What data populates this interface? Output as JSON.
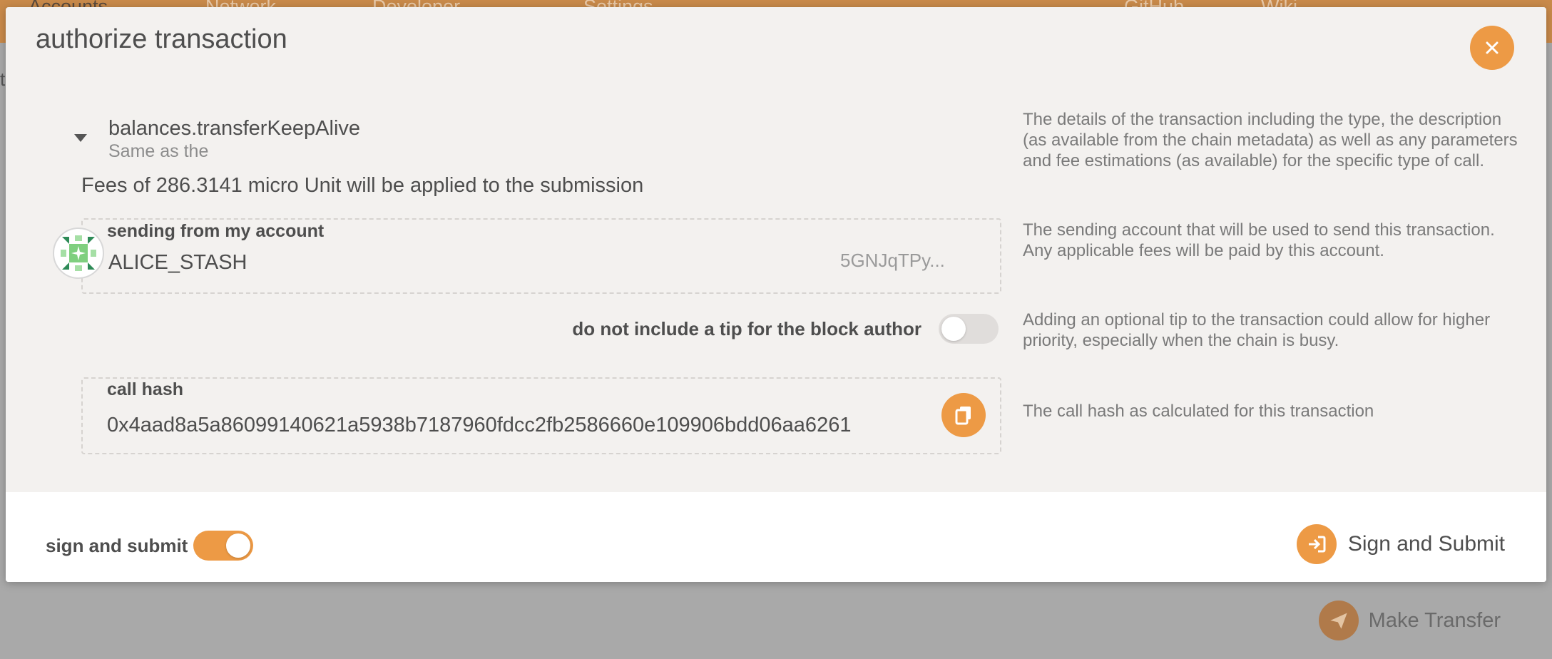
{
  "background": {
    "nav": [
      "Accounts",
      "Network",
      "Developer",
      "Settings",
      "GitHub",
      "Wiki"
    ],
    "fragment": "t",
    "make_transfer_label": "Make Transfer"
  },
  "modal": {
    "title": "authorize transaction",
    "call": {
      "method": "balances.transferKeepAlive",
      "description": "Same as the"
    },
    "fees_text": "Fees of 286.3141 micro Unit will be applied to the submission",
    "account": {
      "label": "sending from my account",
      "name": "ALICE_STASH",
      "address": "5GNJqTPy..."
    },
    "tip": {
      "label": "do not include a tip for the block author",
      "enabled": false
    },
    "call_hash": {
      "label": "call hash",
      "value": "0x4aad8a5a86099140621a5938b7187960fdcc2fb2586660e109906bdd06aa6261"
    },
    "help": {
      "details": "The details of the transaction including the type, the description (as available from the chain metadata) as well as any parameters and fee estimations (as available) for the specific type of call.",
      "account": "The sending account that will be used to send this transaction. Any applicable fees will be paid by this account.",
      "tip": "Adding an optional tip to the transaction could allow for higher priority, especially when the chain is busy.",
      "hash": "The call hash as calculated for this transaction"
    },
    "footer": {
      "toggle_label": "sign and submit",
      "toggle_on": true,
      "submit_label": "Sign and Submit"
    }
  },
  "colors": {
    "accent": "#ed9a45",
    "modal_bg": "#f3f1ef",
    "footer_bg": "#ffffff",
    "text": "#4e4e4e",
    "muted": "#7a7a7a"
  }
}
